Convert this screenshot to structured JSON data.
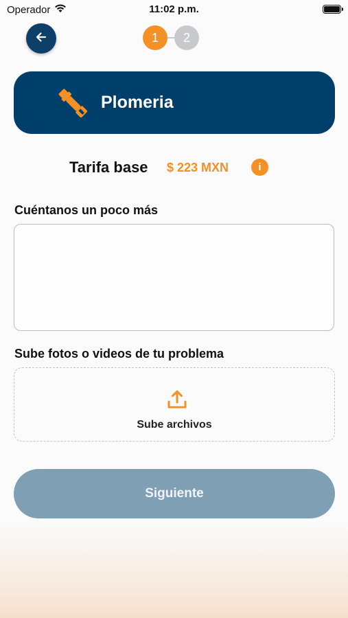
{
  "status_bar": {
    "carrier": "Operador",
    "time": "11:02 p.m."
  },
  "stepper": {
    "steps": [
      "1",
      "2"
    ],
    "active_step": 1
  },
  "service": {
    "name": "Plomeria",
    "icon": "plumbing-wrench-icon"
  },
  "tarifa": {
    "label": "Tarifa base",
    "value": "$ 223 MXN",
    "info_glyph": "i"
  },
  "description": {
    "label": "Cuéntanos un poco más",
    "value": "",
    "placeholder": ""
  },
  "upload": {
    "label": "Sube fotos o videos de tu problema",
    "button_text": "Sube archivos"
  },
  "next_button": {
    "label": "Siguiente"
  },
  "colors": {
    "primary": "#003f69",
    "accent": "#f39026",
    "disabled_button": "#7f9fb5",
    "inactive_step": "#c7c9cc"
  }
}
